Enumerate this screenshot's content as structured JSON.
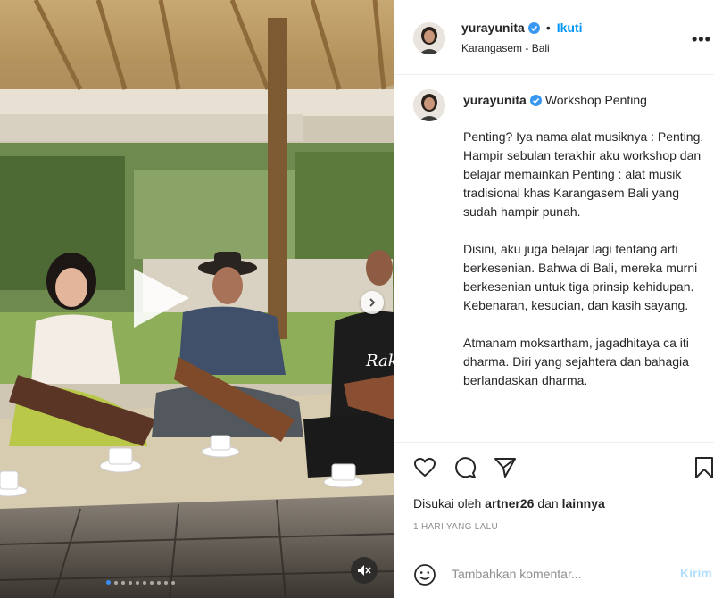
{
  "post": {
    "username": "yurayunita",
    "follow_label": "Ikuti",
    "dot": "•",
    "location": "Karangasem - Bali",
    "more_label": "•••"
  },
  "caption": {
    "username": "yurayunita",
    "title": "Workshop Penting",
    "paragraphs": [
      "Penting? Iya nama alat musiknya : Penting. Hampir sebulan terakhir aku workshop dan belajar memainkan Penting : alat musik tradisional khas Karangasem Bali yang sudah hampir punah.",
      "Disini, aku juga belajar lagi tentang arti berkesenian. Bahwa di Bali, mereka murni berkesenian untuk tiga prinsip kehidupan. Kebenaran, kesucian, dan kasih sayang.",
      "Atmanam moksartham, jagadhitaya ca iti dharma. Diri yang sejahtera dan bahagia berlandaskan dharma."
    ]
  },
  "engagement": {
    "liked_prefix": "Disukai oleh",
    "liked_user": "artner26",
    "liked_joiner": "dan",
    "liked_others": "lainnya",
    "time_ago": "1 HARI YANG LALU"
  },
  "comment": {
    "placeholder": "Tambahkan komentar...",
    "post_label": "Kirim"
  },
  "media": {
    "carousel_count": 10,
    "carousel_active": 0,
    "overlay_text": "Rak"
  },
  "colors": {
    "accent": "#0095f6",
    "verified": "#3897f0",
    "muted": "#8e8e8e",
    "post_disabled": "#b2dffc"
  }
}
